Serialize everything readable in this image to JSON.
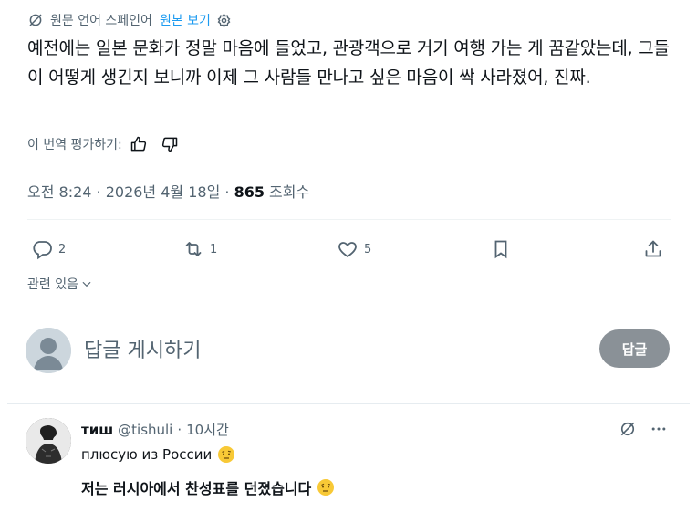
{
  "translation": {
    "label": "원문 언어 스페인어",
    "view_original": "원본 보기"
  },
  "tweet": {
    "text": "예전에는 일본 문화가 정말 마음에 들었고, 관광객으로 거기 여행 가는 게 꿈같았는데, 그들이 어떻게 생긴지 보니까 이제 그 사람들 만나고 싶은 마음이 싹 사라졌어, 진짜.",
    "rate_label": "이 번역 평가하기:",
    "timestamp": "오전 8:24 · 2026년 4월 18일 · ",
    "views_count": "865",
    "views_label": " 조회수"
  },
  "actions": {
    "replies": "2",
    "reposts": "1",
    "likes": "5"
  },
  "related": {
    "label": "관련 있음"
  },
  "reply_composer": {
    "placeholder": "답글 게시하기",
    "button": "답글"
  },
  "reply": {
    "name": "тиш",
    "handle": "@tishuli",
    "separator": "·",
    "time": "10시간",
    "line1": "плюсую из России",
    "line2": "저는 러시아에서 찬성표를 던졌습니다"
  },
  "colors": {
    "link": "#1d9bf0",
    "muted": "#536471",
    "text": "#0f1419"
  }
}
